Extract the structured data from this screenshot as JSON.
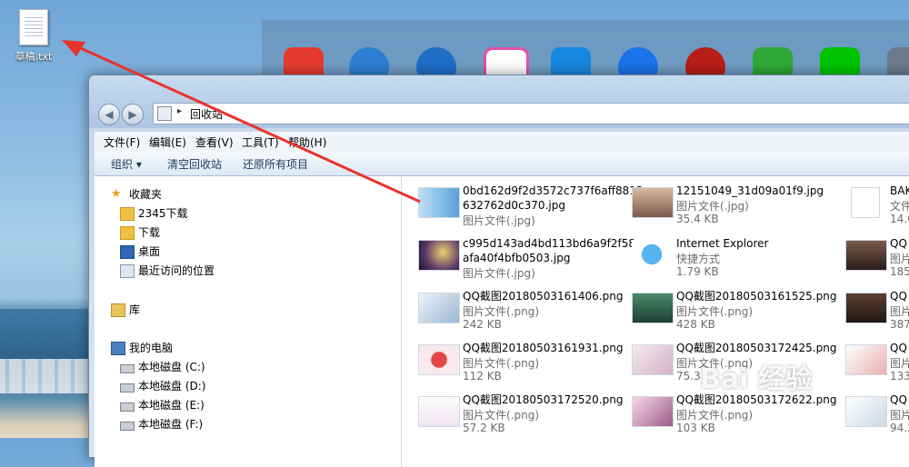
{
  "desktop": {
    "icon_label": "草稿.txt"
  },
  "window": {
    "address": "回收站",
    "menu": [
      "文件(F)",
      "编辑(E)",
      "查看(V)",
      "工具(T)",
      "帮助(H)"
    ],
    "toolbar": [
      "组织 ▾",
      "清空回收站",
      "还原所有项目"
    ],
    "nav": {
      "favorites": "收藏夹",
      "fav_items": [
        "2345下载",
        "下载",
        "桌面",
        "最近访问的位置"
      ],
      "library": "库",
      "computer": "我的电脑",
      "drives": [
        "本地磁盘 (C:)",
        "本地磁盘 (D:)",
        "本地磁盘 (E:)",
        "本地磁盘 (F:)"
      ]
    },
    "files": [
      {
        "name1": "0bd162d9f2d3572c737f6aff8813",
        "name2": "632762d0c370.jpg",
        "type": "图片文件(.jpg)",
        "size": ""
      },
      {
        "name1": "c995d143ad4bd113bd6a9f2f58",
        "name2": "afa40f4bfb0503.jpg",
        "type": "图片文件(.jpg)",
        "size": ""
      },
      {
        "name1": "QQ截图20180503161406.png",
        "name2": "",
        "type": "图片文件(.png)",
        "size": "242 KB"
      },
      {
        "name1": "QQ截图20180503161931.png",
        "name2": "",
        "type": "图片文件(.png)",
        "size": "112 KB"
      },
      {
        "name1": "QQ截图20180503172520.png",
        "name2": "",
        "type": "图片文件(.png)",
        "size": "57.2 KB"
      },
      {
        "name1": "12151049_31d09a01f9.jpg",
        "name2": "",
        "type": "图片文件(.jpg)",
        "size": "35.4 KB"
      },
      {
        "name1": "Internet Explorer",
        "name2": "",
        "type": "快捷方式",
        "size": "1.79 KB"
      },
      {
        "name1": "QQ截图20180503161525.png",
        "name2": "",
        "type": "图片文件(.png)",
        "size": "428 KB"
      },
      {
        "name1": "QQ截图20180503172425.png",
        "name2": "",
        "type": "图片文件(.png)",
        "size": "75.3"
      },
      {
        "name1": "QQ截图20180503172622.png",
        "name2": "",
        "type": "图片文件(.png)",
        "size": "103 KB"
      },
      {
        "name1": "BAK",
        "name2": "",
        "type": "文件",
        "size": "14.6"
      },
      {
        "name1": "QQ",
        "name2": "",
        "type": "图片",
        "size": "185"
      },
      {
        "name1": "QQ",
        "name2": "",
        "type": "图片",
        "size": "387"
      },
      {
        "name1": "QQ",
        "name2": "",
        "type": "图片",
        "size": "133"
      },
      {
        "name1": "QQ",
        "name2": "",
        "type": "图片",
        "size": "94.2"
      }
    ]
  },
  "watermark": "Bai 经验",
  "colors": {
    "arrow": "#e8332d",
    "accent": "#1e395b"
  }
}
